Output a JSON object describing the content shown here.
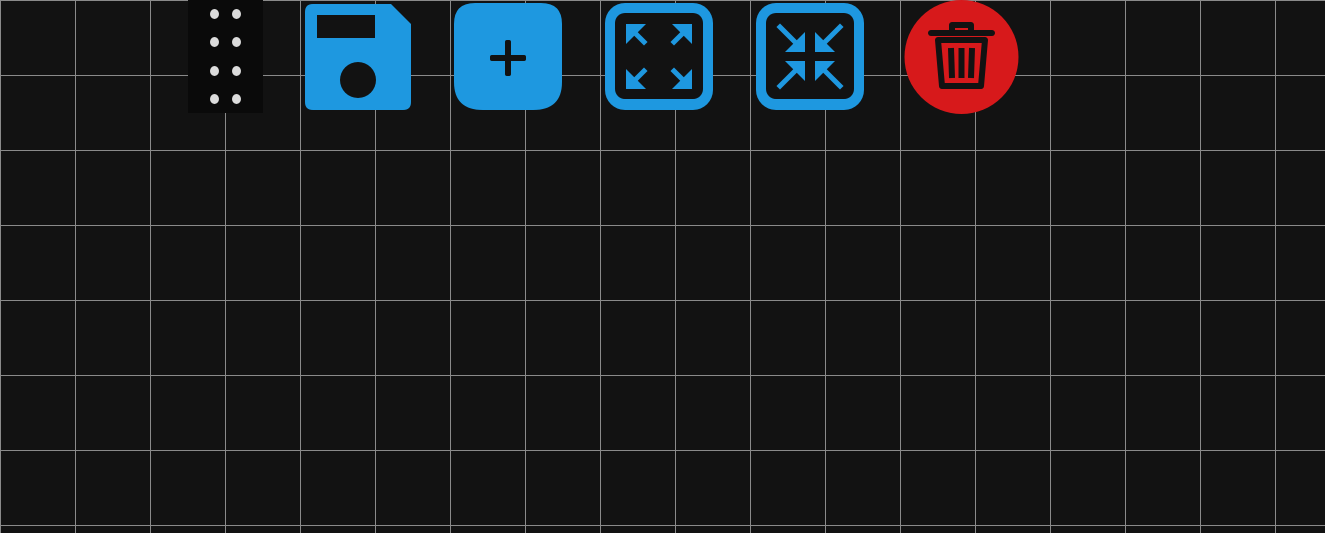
{
  "canvas": {
    "background": "#121212",
    "grid_line_color": "#8a8a8a"
  },
  "toolbar": {
    "accent": "#1e98e0",
    "danger": "#d7191b",
    "buttons": [
      {
        "id": "drag",
        "icon": "drag-handle-icon"
      },
      {
        "id": "save",
        "icon": "floppy-disk-icon"
      },
      {
        "id": "add",
        "icon": "plus-icon"
      },
      {
        "id": "expand",
        "icon": "expand-arrows-icon"
      },
      {
        "id": "collapse",
        "icon": "collapse-arrows-icon"
      },
      {
        "id": "delete",
        "icon": "trash-icon"
      }
    ]
  }
}
